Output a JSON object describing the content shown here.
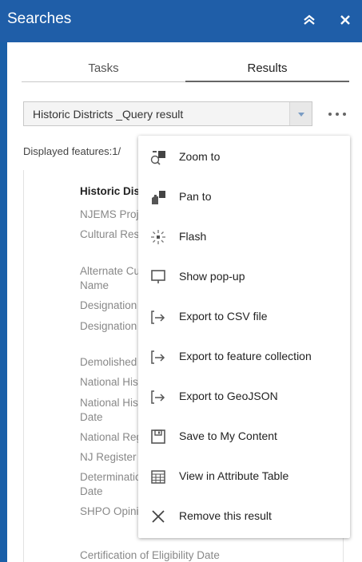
{
  "titlebar": {
    "title": "Searches"
  },
  "tabs": [
    {
      "label": "Tasks"
    },
    {
      "label": "Results"
    }
  ],
  "result_select": {
    "value": "Historic Districts _Query result"
  },
  "displayed": "Displayed features:1/",
  "attributes": {
    "heading": "Historic District",
    "rows": [
      "NJEMS Project",
      "Cultural Resou",
      "Alternate Cultu",
      "Name",
      "Designation St",
      "Designation St",
      "Demolished",
      "National Histor",
      "National Histor",
      "Date",
      "National Regis",
      "NJ Register Da",
      "Determination",
      "Date",
      "SHPO Opinion",
      "Certification of Eligibility Date"
    ]
  },
  "menu": {
    "items": [
      {
        "label": "Zoom to",
        "icon": "zoom-to-icon"
      },
      {
        "label": "Pan to",
        "icon": "pan-to-icon"
      },
      {
        "label": "Flash",
        "icon": "flash-icon"
      },
      {
        "label": "Show pop-up",
        "icon": "popup-icon"
      },
      {
        "label": "Export to CSV file",
        "icon": "export-icon"
      },
      {
        "label": "Export to feature collection",
        "icon": "export-icon"
      },
      {
        "label": "Export to GeoJSON",
        "icon": "export-icon"
      },
      {
        "label": "Save to My Content",
        "icon": "save-icon"
      },
      {
        "label": "View in Attribute Table",
        "icon": "table-icon"
      },
      {
        "label": "Remove this result",
        "icon": "remove-icon"
      }
    ]
  },
  "colors": {
    "header": "#1f5ea8",
    "text": "#222222",
    "muted": "#888888"
  }
}
